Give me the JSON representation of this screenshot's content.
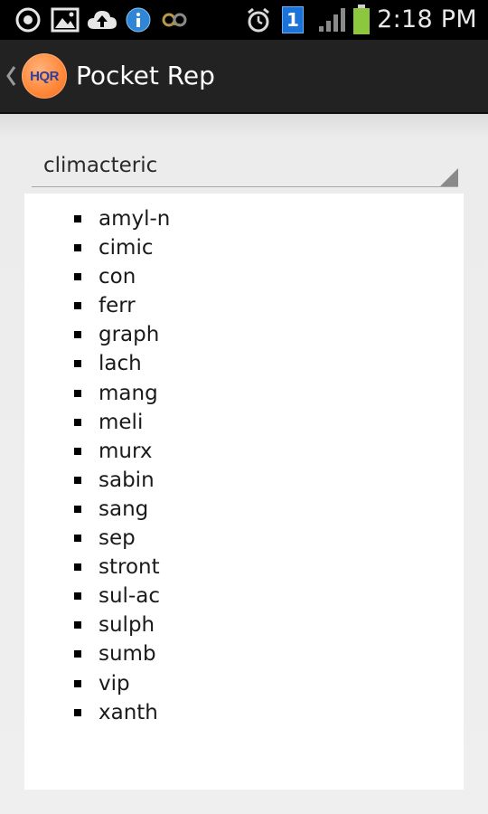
{
  "status_bar": {
    "time": "2:18 PM",
    "notification_icons": [
      "sync-icon",
      "gallery-icon",
      "cloud-upload-icon",
      "info-icon",
      "voicemail-icon"
    ],
    "system_icons": [
      "alarm-icon",
      "sim-indicator-icon",
      "signal-icon",
      "battery-icon"
    ],
    "sim_indicator": "1",
    "battery_color": "#8dc63f"
  },
  "action_bar": {
    "logo_text": "HQR",
    "title": "Pocket Rep",
    "logo_color": "#ff8a3c"
  },
  "spinner": {
    "selected_value": "climacteric"
  },
  "remedies": [
    "amyl-n",
    "cimic",
    "con",
    "ferr",
    "graph",
    "lach",
    "mang",
    "meli",
    "murx",
    "sabin",
    "sang",
    "sep",
    "stront",
    "sul-ac",
    "sulph",
    "sumb",
    "vip",
    "xanth"
  ]
}
